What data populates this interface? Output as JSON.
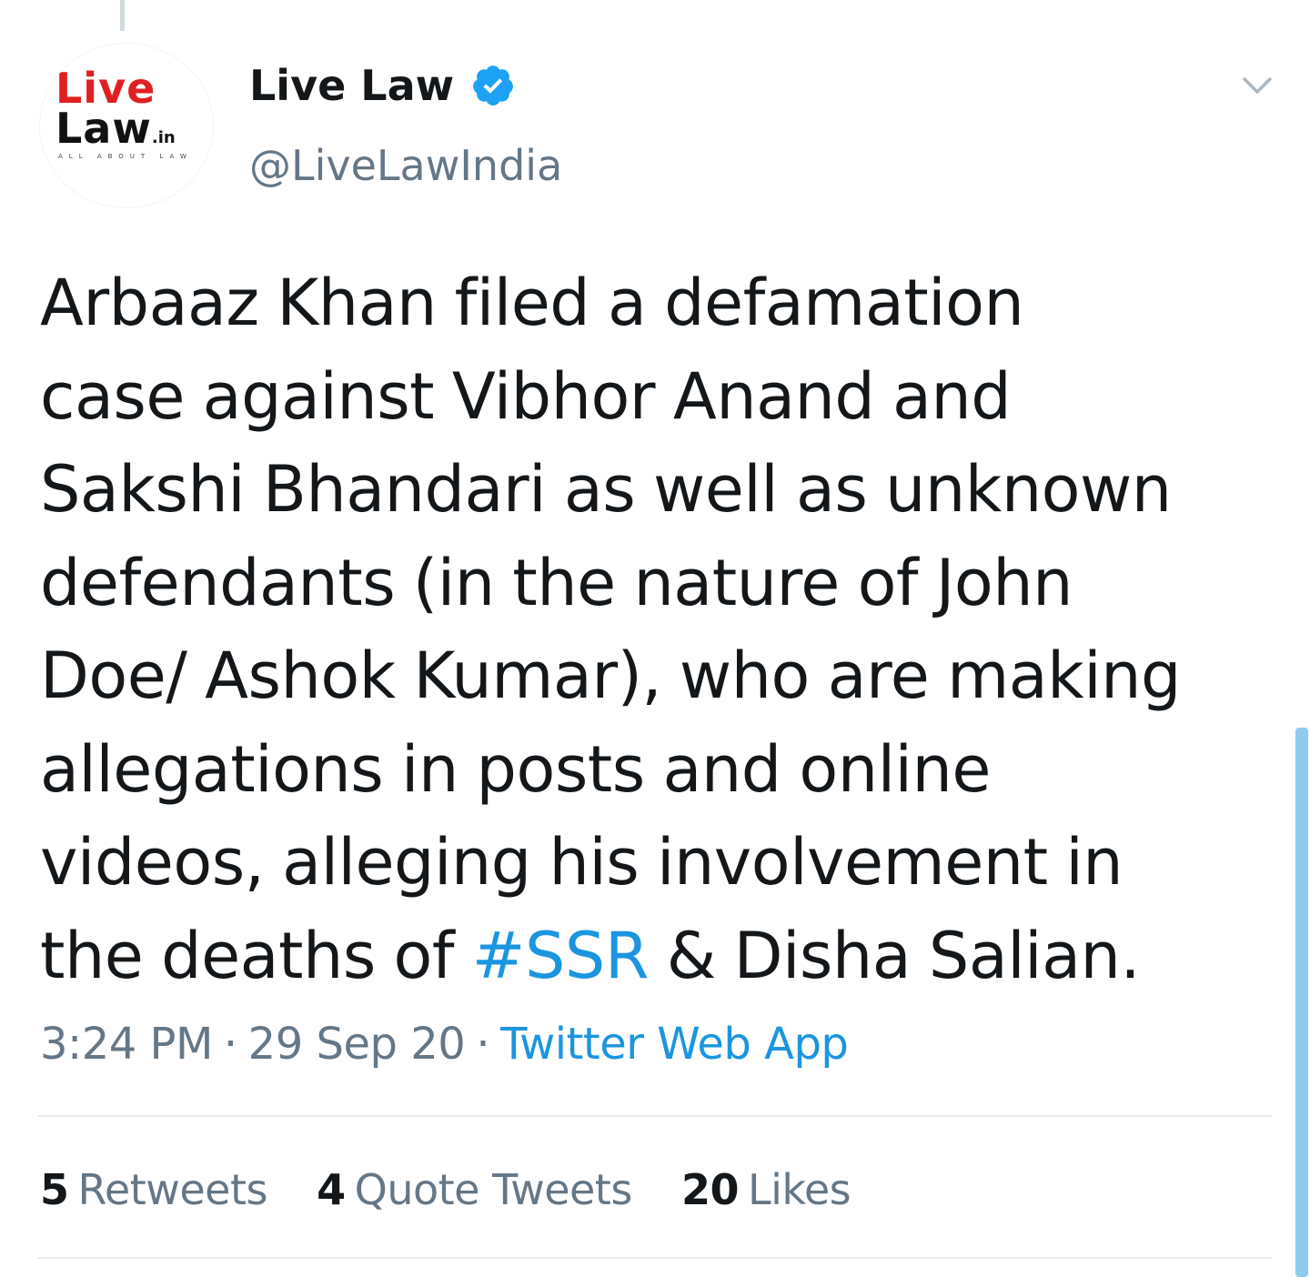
{
  "tweet": {
    "avatar": {
      "icon": "livelaw-logo-icon",
      "logo_live": "Live",
      "logo_law": "Law",
      "logo_in": ".in",
      "logo_tagline": "ALL ABOUT LAW"
    },
    "author": {
      "display_name": "Live Law",
      "handle": "@LiveLawIndia",
      "verified_icon": "verified-badge-icon"
    },
    "menu_icon": "chevron-down-icon",
    "text_lines": [
      "Arbaaz Khan filed a defamation",
      "case against Vibhor Anand and",
      "Sakshi Bhandari as well as unknown",
      "defendants (in the nature of John",
      "Doe/ Ashok Kumar), who are making",
      "allegations in posts and online",
      "videos, alleging his involvement in"
    ],
    "last_line": {
      "before": "the deaths of",
      "hashtag": "#SSR",
      "after": "& Disha Salian."
    },
    "meta": {
      "time": "3:24 PM",
      "separator": "·",
      "date": "29 Sep 20",
      "source": "Twitter Web App"
    },
    "stats": {
      "retweets_count": "5",
      "retweets_label": "Retweets",
      "quotes_count": "4",
      "quotes_label": "Quote Tweets",
      "likes_count": "20",
      "likes_label": "Likes"
    }
  },
  "colors": {
    "link": "#1b95e0",
    "secondary_text": "#657786",
    "primary_text": "#14171a",
    "logo_red": "#e02020"
  }
}
